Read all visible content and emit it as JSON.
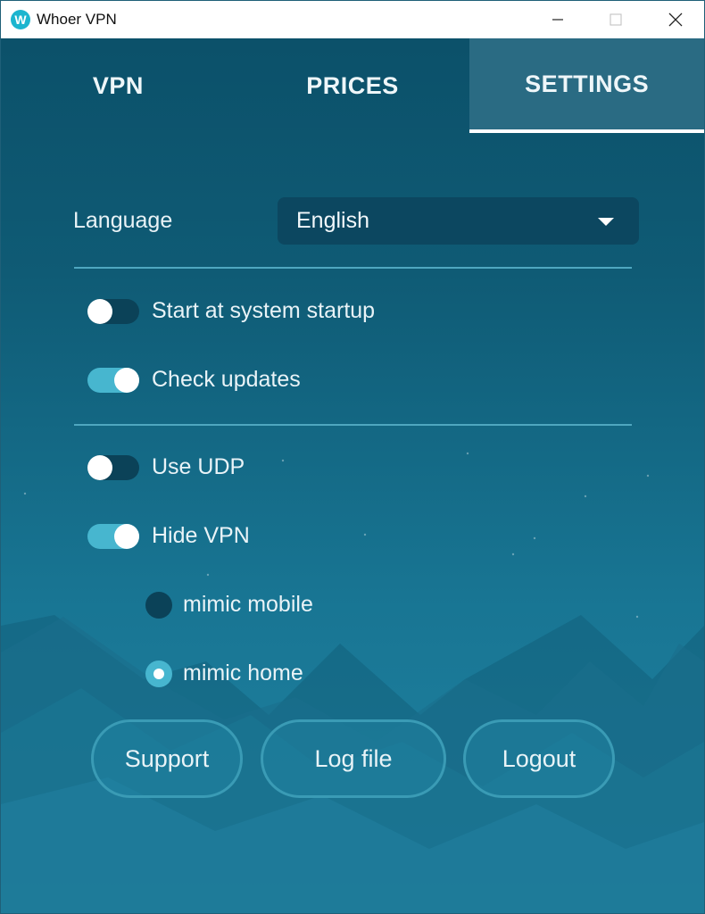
{
  "window": {
    "title": "Whoer VPN",
    "logo_letter": "W",
    "controls": [
      "minimize-icon",
      "maximize-icon",
      "close-icon"
    ]
  },
  "tabs": [
    {
      "label": "VPN",
      "active": false
    },
    {
      "label": "PRICES",
      "active": false
    },
    {
      "label": "SETTINGS",
      "active": true
    }
  ],
  "settings": {
    "language_label": "Language",
    "language_value": "English",
    "toggles": [
      {
        "label": "Start at system startup",
        "on": false
      },
      {
        "label": "Check updates",
        "on": true
      },
      {
        "label": "Use UDP",
        "on": false
      },
      {
        "label": "Hide VPN",
        "on": true
      }
    ],
    "radios": [
      {
        "label": "mimic mobile",
        "checked": false
      },
      {
        "label": "mimic home",
        "checked": true
      }
    ]
  },
  "buttons": {
    "support": "Support",
    "log_file": "Log file",
    "logout": "Logout"
  },
  "colors": {
    "accent": "#47b6cf",
    "background_top": "#0b4f68",
    "background_bottom": "#2184a3"
  }
}
